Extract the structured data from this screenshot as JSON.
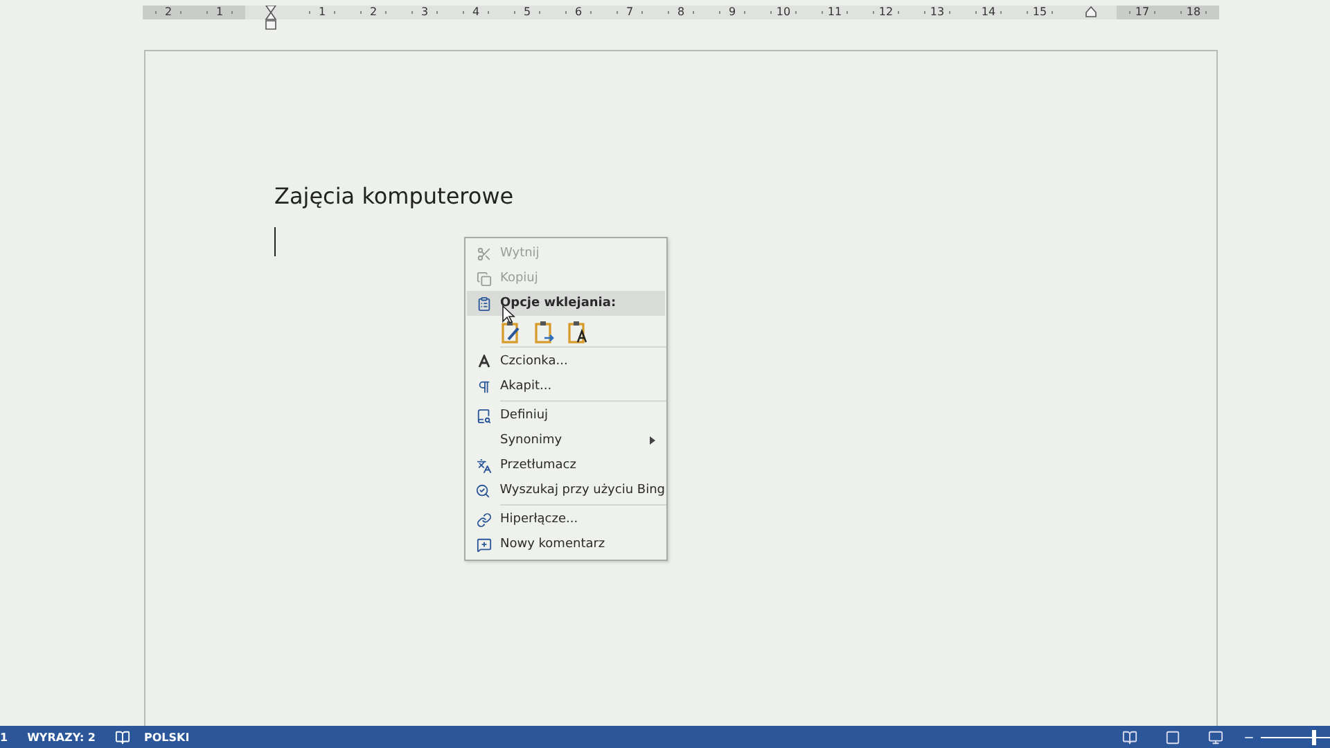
{
  "ruler": {
    "cells": [
      {
        "kind": "number",
        "label": "2"
      },
      {
        "kind": "number",
        "label": "1"
      },
      {
        "kind": "indent-marker"
      },
      {
        "kind": "number",
        "label": "1"
      },
      {
        "kind": "number",
        "label": "2"
      },
      {
        "kind": "number",
        "label": "3"
      },
      {
        "kind": "number",
        "label": "4"
      },
      {
        "kind": "number",
        "label": "5"
      },
      {
        "kind": "number",
        "label": "6"
      },
      {
        "kind": "number",
        "label": "7"
      },
      {
        "kind": "number",
        "label": "8"
      },
      {
        "kind": "number",
        "label": "9"
      },
      {
        "kind": "number",
        "label": "10"
      },
      {
        "kind": "number",
        "label": "11"
      },
      {
        "kind": "number",
        "label": "12"
      },
      {
        "kind": "number",
        "label": "13"
      },
      {
        "kind": "number",
        "label": "14"
      },
      {
        "kind": "number",
        "label": "15"
      },
      {
        "kind": "indent-marker"
      },
      {
        "kind": "number",
        "label": "17"
      },
      {
        "kind": "number",
        "label": "18"
      }
    ]
  },
  "document": {
    "heading": "Zajęcia komputerowe"
  },
  "context_menu": {
    "items": [
      {
        "kind": "item",
        "label": "Wytnij",
        "disabled": true,
        "highlighted": false
      },
      {
        "kind": "item",
        "label": "Kopiuj",
        "disabled": true,
        "highlighted": false
      },
      {
        "kind": "header",
        "label": "Opcje wklejania:",
        "disabled": false,
        "highlighted": true
      },
      {
        "kind": "paste-options"
      },
      {
        "kind": "separator"
      },
      {
        "kind": "item",
        "label": "Czcionka...",
        "disabled": false,
        "highlighted": false
      },
      {
        "kind": "item",
        "label": "Akapit...",
        "disabled": false,
        "highlighted": false
      },
      {
        "kind": "separator"
      },
      {
        "kind": "item",
        "label": "Definiuj",
        "disabled": false,
        "highlighted": false
      },
      {
        "kind": "submenu",
        "label": "Synonimy",
        "disabled": false,
        "highlighted": false
      },
      {
        "kind": "item",
        "label": "Przetłumacz",
        "disabled": false,
        "highlighted": false
      },
      {
        "kind": "item",
        "label": "Wyszukaj przy użyciu Bing",
        "disabled": false,
        "highlighted": false
      },
      {
        "kind": "separator"
      },
      {
        "kind": "item",
        "label": "Hiperłącze...",
        "disabled": false,
        "highlighted": false
      },
      {
        "kind": "item",
        "label": "Nowy komentarz",
        "disabled": false,
        "highlighted": false
      }
    ]
  },
  "status_bar": {
    "page": "1",
    "words": "WYRAZY: 2",
    "language": "POLSKI",
    "zoom": {
      "level": 0.8
    }
  }
}
